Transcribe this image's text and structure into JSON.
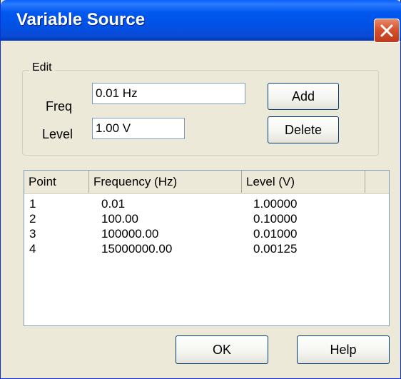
{
  "window": {
    "title": "Variable Source"
  },
  "edit_group": {
    "label": "Edit",
    "freq_label": "Freq",
    "freq_value": "0.01 Hz",
    "level_label": "Level",
    "level_value": "1.00 V",
    "add_label": "Add",
    "delete_label": "Delete"
  },
  "table": {
    "columns": [
      "Point",
      "Frequency (Hz)",
      "Level (V)",
      ""
    ],
    "rows": [
      {
        "point": "1",
        "frequency": "0.01",
        "level": "1.00000"
      },
      {
        "point": "2",
        "frequency": "100.00",
        "level": "0.10000"
      },
      {
        "point": "3",
        "frequency": "100000.00",
        "level": "0.01000"
      },
      {
        "point": "4",
        "frequency": "15000000.00",
        "level": "0.00125"
      }
    ]
  },
  "buttons": {
    "ok_label": "OK",
    "help_label": "Help"
  },
  "icons": {
    "close": "close-icon"
  },
  "colors": {
    "titlebar": "#0058ee",
    "close_button": "#d6532c",
    "dialog_bg": "#ece9d8"
  }
}
